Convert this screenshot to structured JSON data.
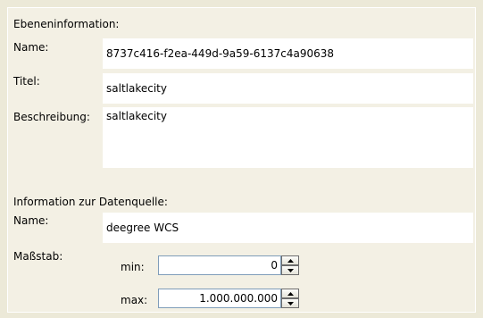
{
  "layer_info": {
    "section_title": "Ebeneninformation:",
    "name_label": "Name:",
    "name_value": "8737c416-f2ea-449d-9a59-6137c4a90638",
    "title_label": "Titel:",
    "title_value": "saltlakecity",
    "description_label": "Beschreibung:",
    "description_value": "saltlakecity"
  },
  "datasource_info": {
    "section_title": "Information zur Datenquelle:",
    "name_label": "Name:",
    "name_value": "deegree WCS",
    "scale_label": "Maßstab:",
    "min_label": "min:",
    "min_value": "0",
    "max_label": "max:",
    "max_value": "1.000.000.000"
  },
  "icons": {
    "spin_up": "arrow-up-icon",
    "spin_down": "arrow-down-icon"
  },
  "colors": {
    "background": "#ece9d8",
    "field_background": "#ffffff",
    "spinner_border": "#7f9db9"
  }
}
